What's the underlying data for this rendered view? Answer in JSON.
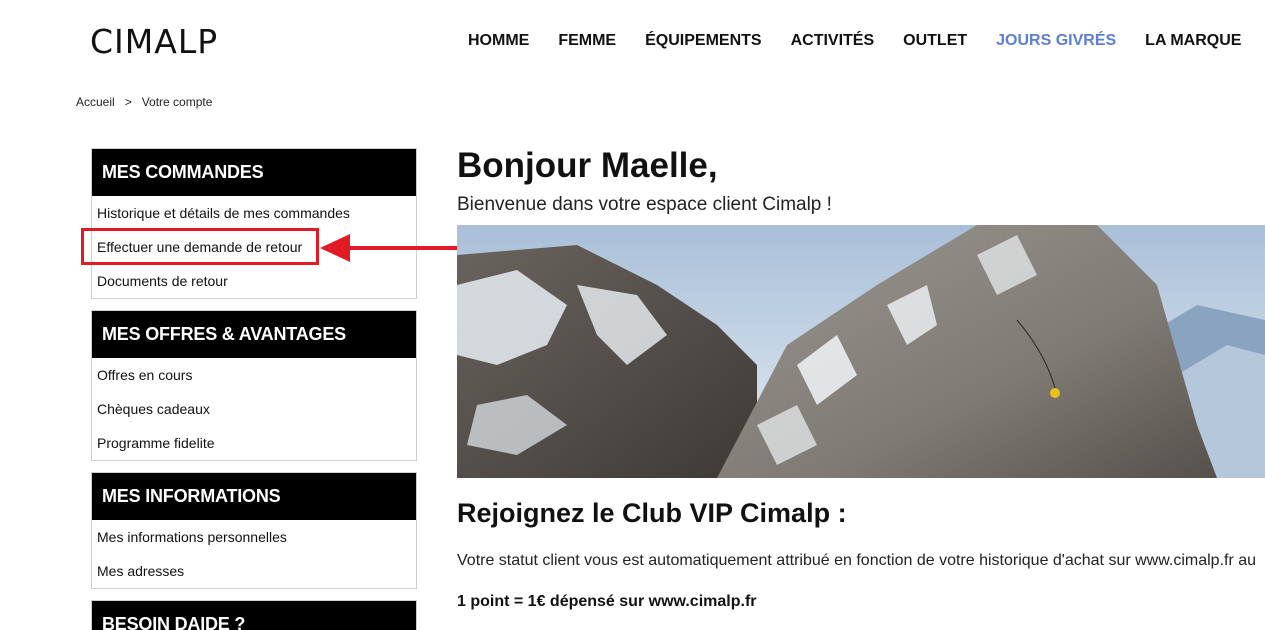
{
  "header": {
    "logo": "CIMALP",
    "nav": [
      {
        "label": "HOMME",
        "accent": false
      },
      {
        "label": "FEMME",
        "accent": false
      },
      {
        "label": "ÉQUIPEMENTS",
        "accent": false
      },
      {
        "label": "ACTIVITÉS",
        "accent": false
      },
      {
        "label": "OUTLET",
        "accent": false
      },
      {
        "label": "JOURS GIVRÉS",
        "accent": true
      },
      {
        "label": "LA MARQUE",
        "accent": false
      }
    ],
    "accent_color": "#5b7fd6"
  },
  "breadcrumb": {
    "home": "Accueil",
    "separator": ">",
    "current": "Votre compte"
  },
  "sidebar": {
    "sections": [
      {
        "title": "MES COMMANDES",
        "items": [
          "Historique et détails de mes commandes",
          "Effectuer une demande de retour",
          "Documents de retour"
        ]
      },
      {
        "title": "MES OFFRES & AVANTAGES",
        "items": [
          "Offres en cours",
          "Chèques cadeaux",
          "Programme fidelite"
        ]
      },
      {
        "title": "MES INFORMATIONS",
        "items": [
          "Mes informations personnelles",
          "Mes adresses"
        ]
      },
      {
        "title": "BESOIN DAIDE ?",
        "items": []
      }
    ],
    "highlight_color": "#e01b24"
  },
  "main": {
    "greeting": "Bonjour Maelle,",
    "welcome": "Bienvenue dans votre espace client Cimalp !",
    "club_title": "Rejoignez le Club VIP Cimalp :",
    "club_text": "Votre statut client vous est automatiquement attribué en fonction de votre historique d'achat sur www.cimalp.fr au",
    "club_points": "1 point = 1€ dépensé sur www.cimalp.fr"
  }
}
